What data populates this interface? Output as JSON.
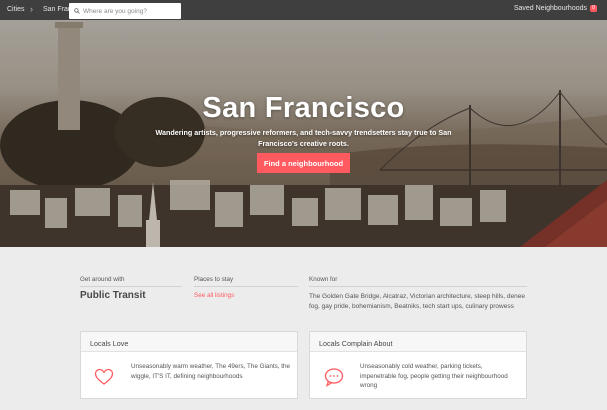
{
  "nav": {
    "breadcrumb_cities": "Cities",
    "breadcrumb_city": "San Fran",
    "search_placeholder": "Where are you going?",
    "saved_label": "Saved Neighbourhoods",
    "saved_count": "0"
  },
  "hero": {
    "title": "San Francisco",
    "subtitle": "Wandering artists, progressive reformers, and tech-savvy trendsetters stay true to San Francisco's creative roots.",
    "cta_label": "Find a neighbourhood"
  },
  "info": {
    "transit_label": "Get around with",
    "transit_value": "Public Transit",
    "stay_label": "Places to stay",
    "stay_link": "See all listings",
    "known_label": "Known for",
    "known_value": "The Golden Gate Bridge, Alcatraz, Victorian architecture, steep hills, denee fog, gay pride, bohemianism, Beatniks, tech start ups, culinary prowess"
  },
  "cards": {
    "love_title": "Locals Love",
    "love_text": "Unseasonably warm weather, The 49ers, The Giants, the wiggle, IT'S IT, defining neighbourhoods",
    "complain_title": "Locals Complain About",
    "complain_text": "Unseasonably cold weather, parking tickets, impenetrable fog, people getting their neighbourhood wrong"
  },
  "colors": {
    "accent": "#ff5a5f",
    "nav_bg": "#3f3f3f",
    "page_bg": "#ececec"
  },
  "icons": {
    "search": "search-icon",
    "heart": "heart-icon",
    "complain": "speech-bubble-icon",
    "breadcrumb_separator": "chevron-right-icon"
  }
}
